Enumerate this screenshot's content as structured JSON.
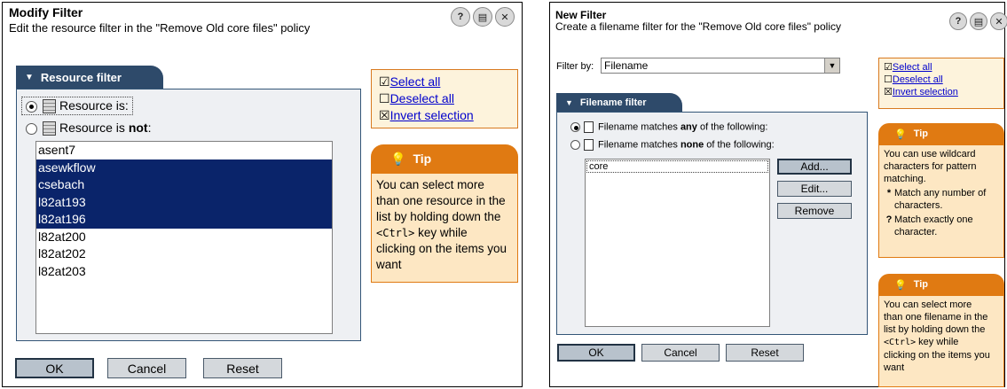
{
  "left": {
    "title": "Modify Filter",
    "subtitle": "Edit the resource filter in the \"Remove Old core files\" policy",
    "header_buttons": [
      "?",
      "▤",
      "✕"
    ],
    "tab_label": "Resource filter",
    "radio1_label": "Resource is:",
    "radio2_prefix": "Resource is ",
    "radio2_bold": "not",
    "radio2_suffix": ":",
    "list": [
      {
        "text": "asent7",
        "selected": false
      },
      {
        "text": "asewkflow",
        "selected": true
      },
      {
        "text": "csebach",
        "selected": true
      },
      {
        "text": "l82at193",
        "selected": true
      },
      {
        "text": "l82at196",
        "selected": true
      },
      {
        "text": "l82at200",
        "selected": false
      },
      {
        "text": "l82at202",
        "selected": false
      },
      {
        "text": "l82at203",
        "selected": false
      }
    ],
    "select_all": "Select all",
    "deselect_all": "Deselect all",
    "invert_selection": "Invert selection",
    "tip_title": "Tip",
    "tip_lines": [
      "You can select more",
      "than one resource in the",
      "list by holding down the"
    ],
    "tip_code": "<Ctrl>",
    "tip_after_code": " key while",
    "tip_lines2": [
      "clicking on the items you",
      "want"
    ],
    "ok": "OK",
    "cancel": "Cancel",
    "reset": "Reset"
  },
  "right": {
    "title": "New Filter",
    "subtitle": "Create a filename filter for the \"Remove Old core files\" policy",
    "header_buttons": [
      "?",
      "▤",
      "✕"
    ],
    "filter_by_label": "Filter by:",
    "filter_by_value": "Filename",
    "tab_label": "Filename filter",
    "radio1_prefix": "Filename matches ",
    "radio1_bold": "any",
    "radio1_suffix": " of the following:",
    "radio2_prefix": "Filename matches ",
    "radio2_bold": "none",
    "radio2_suffix": " of the following:",
    "list": [
      {
        "text": "core",
        "selected": false
      }
    ],
    "add": "Add...",
    "edit": "Edit...",
    "remove": "Remove",
    "select_all": "Select all",
    "deselect_all": "Deselect all",
    "invert_selection": "Invert selection",
    "tip1_title": "Tip",
    "tip1_lines": [
      "You can use wildcard",
      "characters for pattern",
      "matching."
    ],
    "tip1_bullet1_mark": "*",
    "tip1_bullet1_text": "Match any number of characters.",
    "tip1_bullet2_mark": "?",
    "tip1_bullet2_text": "Match exactly one character.",
    "tip2_title": "Tip",
    "tip2_lines": [
      "You can select more",
      "than one filename in the",
      "list by holding down the"
    ],
    "tip2_code": "<Ctrl>",
    "tip2_after_code": " key while",
    "tip2_lines2": [
      "clicking on the items you",
      "want"
    ],
    "ok": "OK",
    "cancel": "Cancel",
    "reset": "Reset"
  },
  "colors": {
    "tab": "#2e4a6a",
    "selection": "#0a246a",
    "tip_orange": "#e07a12",
    "tip_body": "#fde7c3",
    "link": "#0000cc"
  }
}
